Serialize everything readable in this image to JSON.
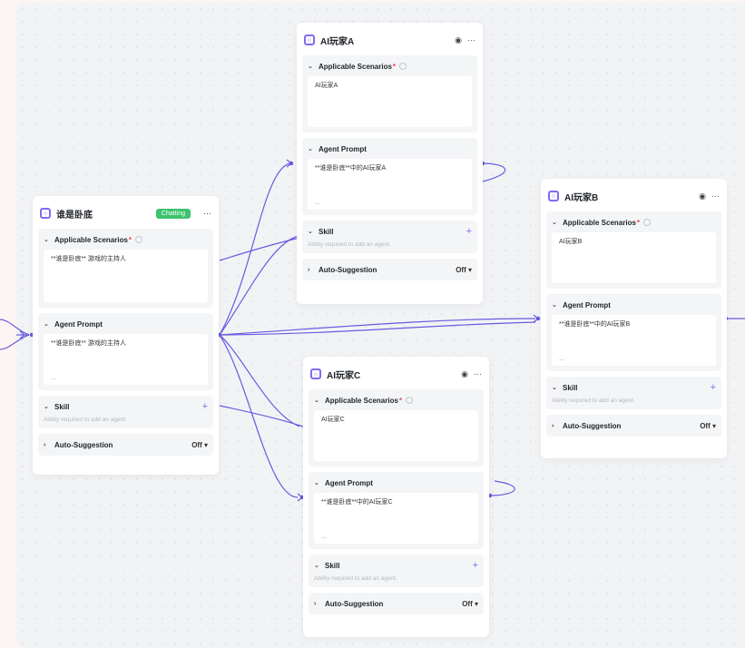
{
  "colors": {
    "accent": "#7f6cf3",
    "status_chatting": "#3ec26d",
    "required": "#e5484d"
  },
  "sections": {
    "scenarios_label": "Applicable Scenarios",
    "prompt_label": "Agent Prompt",
    "skill_label": "Skill",
    "skill_hint": "Ability required to add an agent.",
    "autosuggest_label": "Auto-Suggestion",
    "autosuggest_value": "Off ▾",
    "required_mark": "*",
    "ellipsis": "..."
  },
  "cards": {
    "host": {
      "title": "谁是卧底",
      "status": "Chatting",
      "scenario": "**谁是卧底** 游戏的主持人",
      "prompt": "**谁是卧底** 游戏的主持人"
    },
    "a": {
      "title": "AI玩家A",
      "scenario": "AI玩家A",
      "prompt": "**谁是卧底**中的AI玩家A"
    },
    "b": {
      "title": "AI玩家B",
      "scenario": "AI玩家B",
      "prompt": "**谁是卧底**中的AI玩家B"
    },
    "c": {
      "title": "AI玩家C",
      "scenario": "AI玩家C",
      "prompt": "**谁是卧底**中的AI玩家C"
    }
  }
}
